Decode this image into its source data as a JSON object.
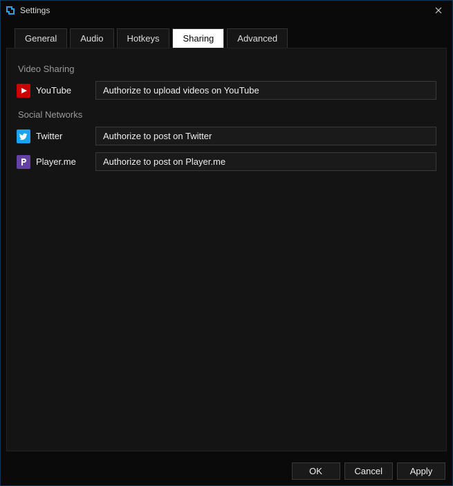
{
  "window": {
    "title": "Settings"
  },
  "tabs": [
    {
      "label": "General"
    },
    {
      "label": "Audio"
    },
    {
      "label": "Hotkeys"
    },
    {
      "label": "Sharing",
      "active": true
    },
    {
      "label": "Advanced"
    }
  ],
  "sections": {
    "video_sharing": {
      "title": "Video Sharing",
      "youtube": {
        "label": "YouTube",
        "button": "Authorize to upload videos on YouTube"
      }
    },
    "social_networks": {
      "title": "Social Networks",
      "twitter": {
        "label": "Twitter",
        "button": "Authorize to post on Twitter"
      },
      "playerme": {
        "label": "Player.me",
        "button": "Authorize to post on Player.me"
      }
    }
  },
  "footer": {
    "ok": "OK",
    "cancel": "Cancel",
    "apply": "Apply"
  }
}
